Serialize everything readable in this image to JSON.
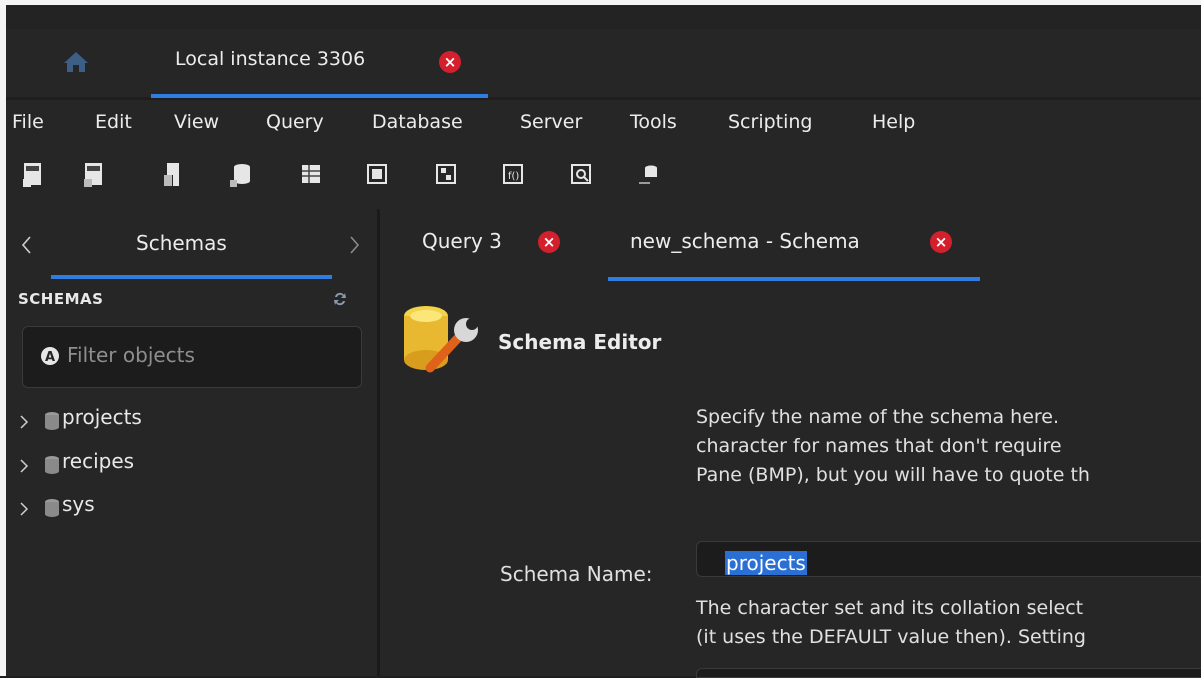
{
  "connection_tab": {
    "label": "Local instance 3306"
  },
  "menu": [
    "File",
    "Edit",
    "View",
    "Query",
    "Database",
    "Server",
    "Tools",
    "Scripting",
    "Help"
  ],
  "toolbar": {
    "icons": [
      "new-sql-tab-icon",
      "open-sql-script-icon",
      "inspector-icon",
      "create-schema-icon",
      "create-table-icon",
      "create-view-icon",
      "create-procedure-icon",
      "create-function-icon",
      "search-table-data-icon",
      "reconnect-icon"
    ]
  },
  "left_panel": {
    "tab_label": "Schemas",
    "section_title": "SCHEMAS",
    "filter_placeholder": "Filter objects",
    "schemas": [
      "projects",
      "recipes",
      "sys"
    ]
  },
  "editor_tabs": [
    {
      "label": "Query 3",
      "active": false
    },
    {
      "label": "new_schema - Schema",
      "active": true
    }
  ],
  "schema_editor": {
    "title": "Schema Editor",
    "description_lines": [
      "Specify the name of the schema here.",
      "character for names that don't require",
      "Pane (BMP), but you will have to quote th"
    ],
    "schema_name_label": "Schema Name:",
    "schema_name_value": "projects",
    "charset_lines": [
      "The character set and its collation select",
      "(it uses the DEFAULT value then). Setting"
    ]
  },
  "colors": {
    "accent": "#2f7de1",
    "close_badge": "#d4202c",
    "background": "#262626"
  }
}
